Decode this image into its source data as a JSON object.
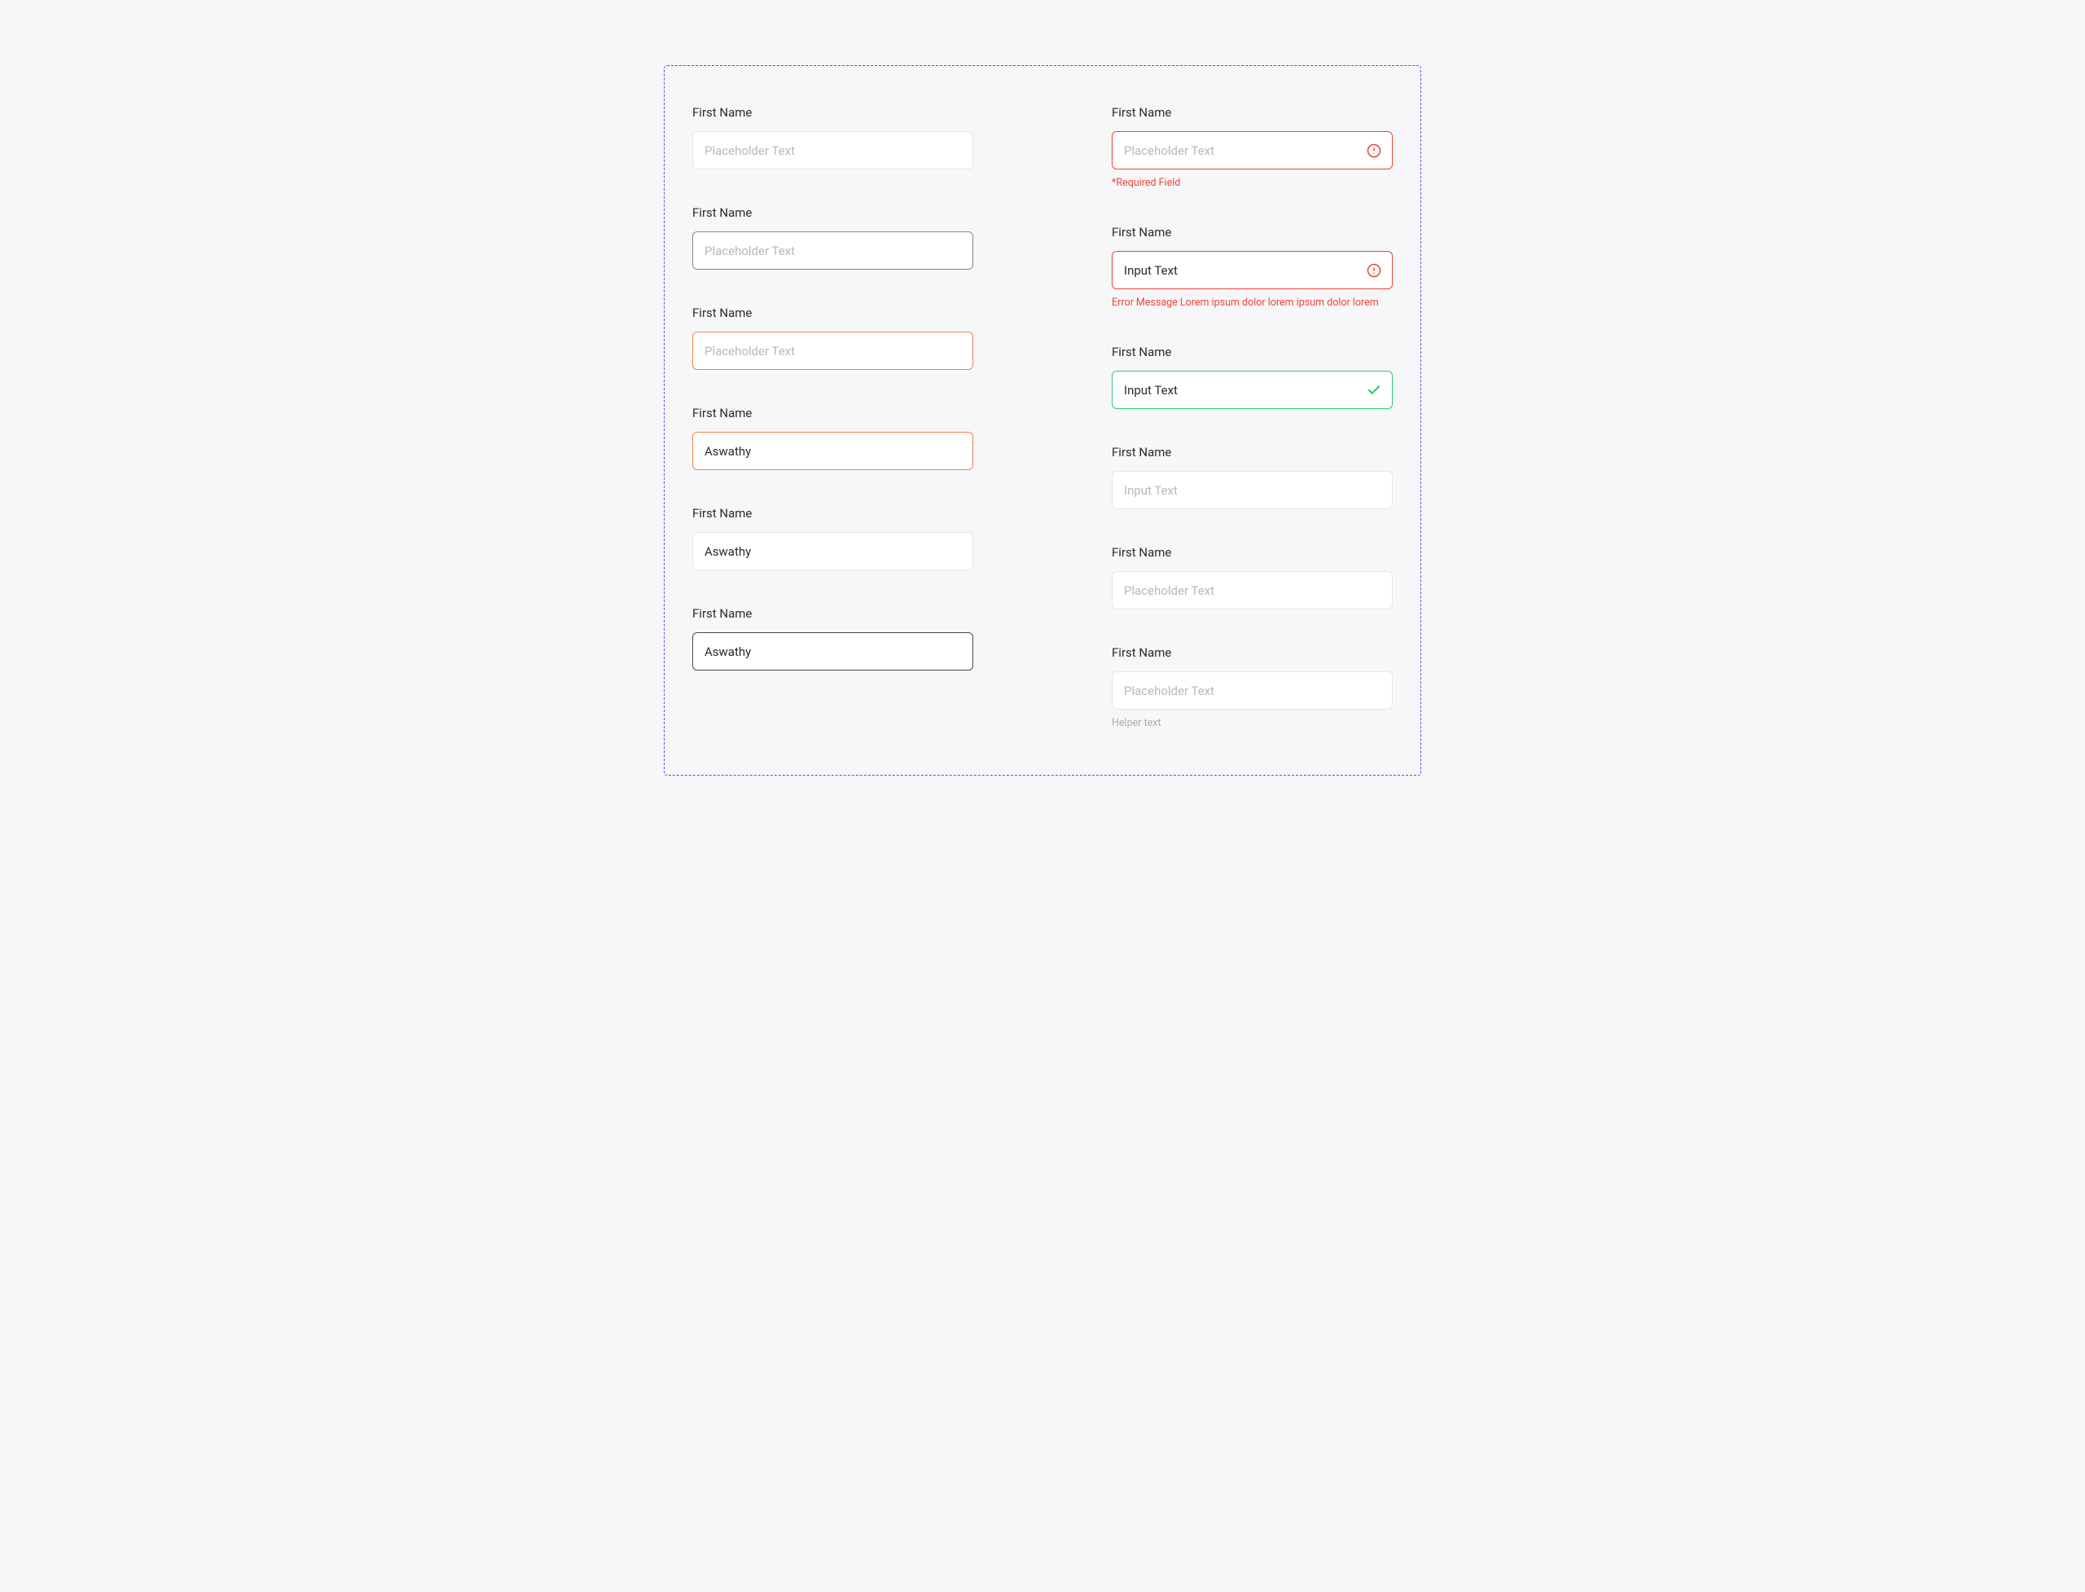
{
  "left": {
    "f1": {
      "label": "First Name",
      "placeholder": "Placeholder Text"
    },
    "f2": {
      "label": "First Name",
      "placeholder": "Placeholder Text"
    },
    "f3": {
      "label": "First Name",
      "placeholder": "Placeholder Text"
    },
    "f4": {
      "label": "First Name",
      "value": "Aswathy"
    },
    "f5": {
      "label": "First Name",
      "value": "Aswathy"
    },
    "f6": {
      "label": "First Name",
      "value": "Aswathy"
    }
  },
  "right": {
    "f1": {
      "label": "First Name",
      "placeholder": "Placeholder Text",
      "hint": "*Required Field"
    },
    "f2": {
      "label": "First Name",
      "value": "Input Text",
      "hint": "Error Message Lorem ipsum dolor lorem ipsum dolor lorem"
    },
    "f3": {
      "label": "First Name",
      "value": "Input Text"
    },
    "f4": {
      "label": "First Name",
      "value": "Input Text"
    },
    "f5": {
      "label": "First Name",
      "placeholder": "Placeholder Text"
    },
    "f6": {
      "label": "First Name",
      "placeholder": "Placeholder Text",
      "hint": "Helper text"
    }
  }
}
